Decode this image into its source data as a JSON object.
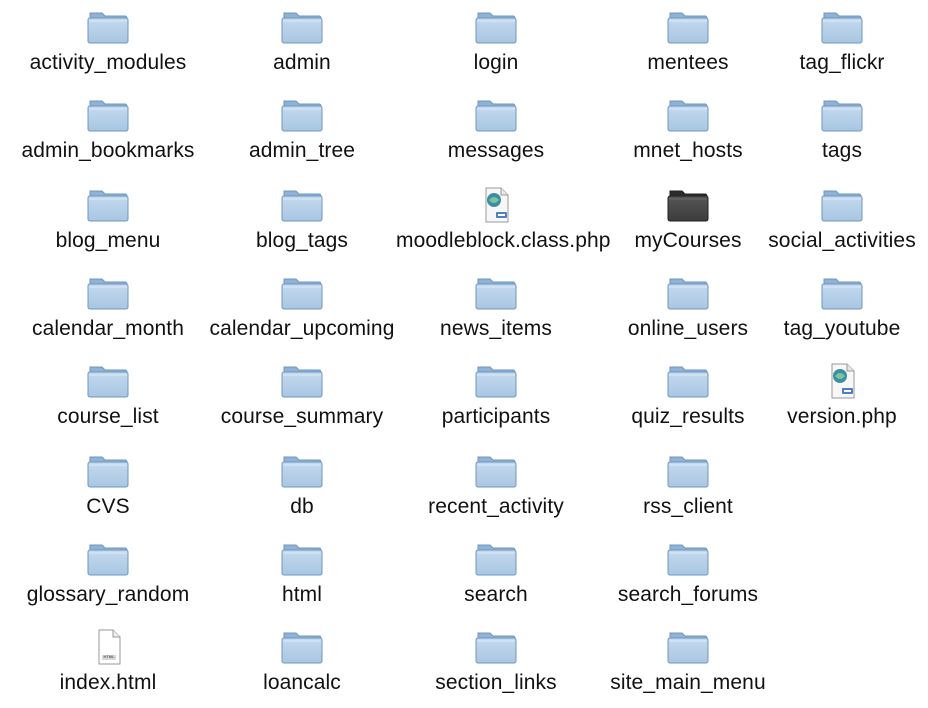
{
  "window": {
    "view": "Finder icon view"
  },
  "colors": {
    "folder_body": "#a8c6e2",
    "folder_edge": "#6f96bd",
    "folder_tab": "#8fb3d6",
    "folder_dark": "#3d3d3d",
    "text": "#111111"
  },
  "items": [
    {
      "name": "activity_modules",
      "kind": "folder",
      "icon": "folder-icon"
    },
    {
      "name": "admin",
      "kind": "folder",
      "icon": "folder-icon"
    },
    {
      "name": "login",
      "kind": "folder",
      "icon": "folder-icon"
    },
    {
      "name": "mentees",
      "kind": "folder",
      "icon": "folder-icon"
    },
    {
      "name": "tag_flickr",
      "kind": "folder",
      "icon": "folder-icon"
    },
    {
      "name": "admin_bookmarks",
      "kind": "folder",
      "icon": "folder-icon"
    },
    {
      "name": "admin_tree",
      "kind": "folder",
      "icon": "folder-icon"
    },
    {
      "name": "messages",
      "kind": "folder",
      "icon": "folder-icon"
    },
    {
      "name": "mnet_hosts",
      "kind": "folder",
      "icon": "folder-icon"
    },
    {
      "name": "tags",
      "kind": "folder",
      "icon": "folder-icon"
    },
    {
      "name": "blog_menu",
      "kind": "folder",
      "icon": "folder-icon"
    },
    {
      "name": "blog_tags",
      "kind": "folder",
      "icon": "folder-icon"
    },
    {
      "name": "moodleblock.class.php",
      "kind": "php",
      "icon": "php-file-icon"
    },
    {
      "name": "myCourses",
      "kind": "folder-dark",
      "icon": "dark-folder-icon"
    },
    {
      "name": "social_activities",
      "kind": "folder",
      "icon": "folder-icon"
    },
    {
      "name": "calendar_month",
      "kind": "folder",
      "icon": "folder-icon"
    },
    {
      "name": "calendar_upcoming",
      "kind": "folder",
      "icon": "folder-icon"
    },
    {
      "name": "news_items",
      "kind": "folder",
      "icon": "folder-icon"
    },
    {
      "name": "online_users",
      "kind": "folder",
      "icon": "folder-icon"
    },
    {
      "name": "tag_youtube",
      "kind": "folder",
      "icon": "folder-icon"
    },
    {
      "name": "course_list",
      "kind": "folder",
      "icon": "folder-icon"
    },
    {
      "name": "course_summary",
      "kind": "folder",
      "icon": "folder-icon"
    },
    {
      "name": "participants",
      "kind": "folder",
      "icon": "folder-icon"
    },
    {
      "name": "quiz_results",
      "kind": "folder",
      "icon": "folder-icon"
    },
    {
      "name": "version.php",
      "kind": "php",
      "icon": "php-file-icon"
    },
    {
      "name": "CVS",
      "kind": "folder",
      "icon": "folder-icon"
    },
    {
      "name": "db",
      "kind": "folder",
      "icon": "folder-icon"
    },
    {
      "name": "recent_activity",
      "kind": "folder",
      "icon": "folder-icon"
    },
    {
      "name": "rss_client",
      "kind": "folder",
      "icon": "folder-icon"
    },
    {
      "name": "glossary_random",
      "kind": "folder",
      "icon": "folder-icon"
    },
    {
      "name": "html",
      "kind": "folder",
      "icon": "folder-icon"
    },
    {
      "name": "search",
      "kind": "folder",
      "icon": "folder-icon"
    },
    {
      "name": "search_forums",
      "kind": "folder",
      "icon": "folder-icon"
    },
    {
      "name": "index.html",
      "kind": "html",
      "icon": "html-file-icon",
      "badge": "HTML"
    },
    {
      "name": "loancalc",
      "kind": "folder",
      "icon": "folder-icon"
    },
    {
      "name": "section_links",
      "kind": "folder",
      "icon": "folder-icon"
    },
    {
      "name": "site_main_menu",
      "kind": "folder",
      "icon": "folder-icon"
    }
  ]
}
